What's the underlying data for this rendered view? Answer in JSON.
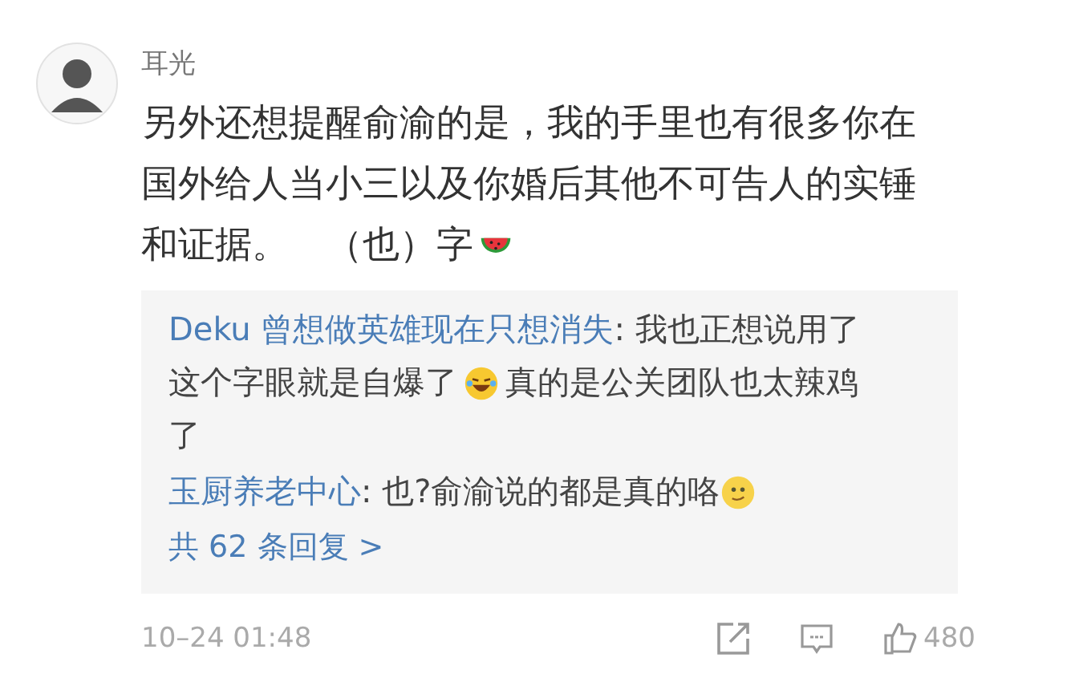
{
  "comment": {
    "author": "耳光",
    "lines": [
      {
        "text": "另外还想提醒俞渝的是，我的手里也有很多你在",
        "emoji": false
      },
      {
        "text": "国外给人当小三以及你婚后其他不可告人的实锤",
        "emoji": false
      },
      {
        "text": "和证据。　（也）字",
        "emoji": true
      }
    ],
    "replies": [
      {
        "author": "Deku 曾想做英雄现在只想消失",
        "lines": [
          {
            "text": ": 我也正想说用了",
            "emoji": false
          },
          {
            "text": "这个字眼就是自爆了",
            "emoji": true,
            "text_after": "真的是公关团队也太辣鸡"
          },
          {
            "text": "了",
            "emoji": false
          }
        ]
      },
      {
        "author": "玉厨养老中心",
        "lines": [
          {
            "text": ": 也?俞渝说的都是真的咯",
            "emoji": true
          }
        ]
      }
    ],
    "more_replies": "共 62 条回复 >",
    "time": "10–24 01:48",
    "likes": "480"
  }
}
